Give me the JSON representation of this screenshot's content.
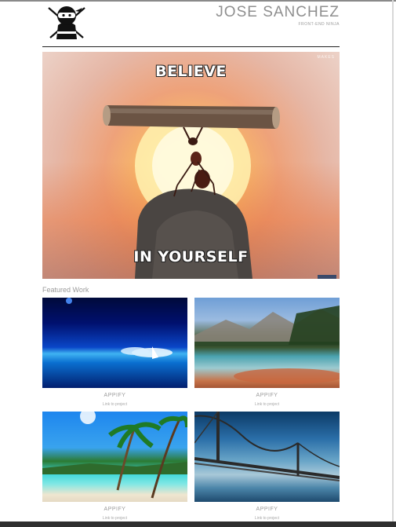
{
  "header": {
    "name": "JOSE SANCHEZ",
    "tagline": "FRONT-END NINJA",
    "logo_icon": "ninja-icon"
  },
  "hero": {
    "caption_top": "BELIEVE",
    "caption_bottom": "IN YOURSELF",
    "watermark": "MAKES"
  },
  "featured": {
    "title": "Featured Work",
    "items": [
      {
        "label": "APPIFY",
        "link": "Link to project",
        "image": "space-ocean-sailboat"
      },
      {
        "label": "APPIFY",
        "link": "Link to project",
        "image": "mountain-lake"
      },
      {
        "label": "APPIFY",
        "link": "Link to project",
        "image": "tropical-beach"
      },
      {
        "label": "APPIFY",
        "link": "Link to project",
        "image": "suspension-bridge"
      }
    ]
  },
  "colors": {
    "text_muted": "#9a9a9a",
    "divider": "#222222",
    "footer_bar": "#2f2f2f"
  }
}
